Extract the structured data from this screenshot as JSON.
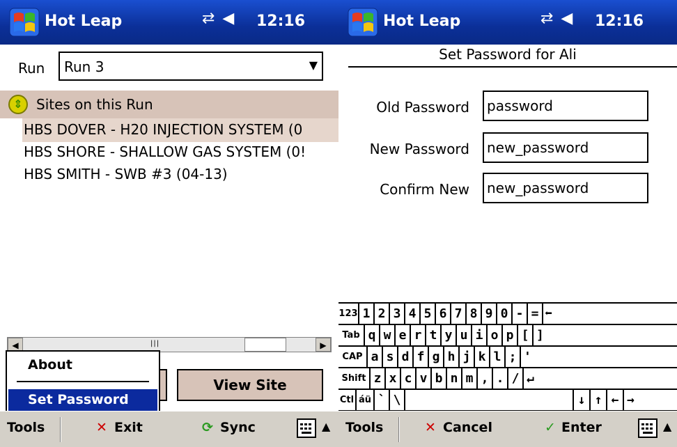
{
  "status": {
    "app_title": "Hot Leap",
    "time": "12:16",
    "connection_icon": "connectivity-icon",
    "volume_icon": "speaker-icon"
  },
  "left": {
    "run_label": "Run",
    "run_value": "Run 3",
    "list_header": "Sites on this Run",
    "sites": [
      "HBS DOVER - H20 INJECTION SYSTEM (0",
      "HBS SHORE - SHALLOW GAS SYSTEM (0!",
      "HBS SMITH - SWB #3  (04-13)"
    ],
    "view_site_label": "View Site",
    "menu": {
      "about": "About",
      "set_password": "Set Password"
    },
    "menubar": {
      "tools": "Tools",
      "exit": "Exit",
      "sync": "Sync"
    }
  },
  "right": {
    "page_title": "Set Password for Ali",
    "fields": [
      {
        "label": "Old Password",
        "value": "password"
      },
      {
        "label": "New Password",
        "value": "new_password"
      },
      {
        "label": "Confirm New",
        "value": "new_password"
      }
    ],
    "menubar": {
      "tools": "Tools",
      "cancel": "Cancel",
      "enter": "Enter"
    }
  },
  "keyboard": {
    "rows": [
      [
        "123",
        "1",
        "2",
        "3",
        "4",
        "5",
        "6",
        "7",
        "8",
        "9",
        "0",
        "-",
        "=",
        "⬅"
      ],
      [
        "Tab",
        "q",
        "w",
        "e",
        "r",
        "t",
        "y",
        "u",
        "i",
        "o",
        "p",
        "[",
        "]"
      ],
      [
        "CAP",
        "a",
        "s",
        "d",
        "f",
        "g",
        "h",
        "j",
        "k",
        "l",
        ";",
        "'"
      ],
      [
        "Shift",
        "z",
        "x",
        "c",
        "v",
        "b",
        "n",
        "m",
        ",",
        ".",
        "/",
        "↵"
      ],
      [
        "Ctl",
        "áü",
        "`",
        "\\",
        "",
        "↓",
        "↑",
        "←",
        "→"
      ]
    ]
  },
  "colors": {
    "titlebar": "#0b2f98",
    "selection": "#0b2a9e",
    "list_header": "#d7c3b8",
    "menubar": "#d4d0c8"
  }
}
